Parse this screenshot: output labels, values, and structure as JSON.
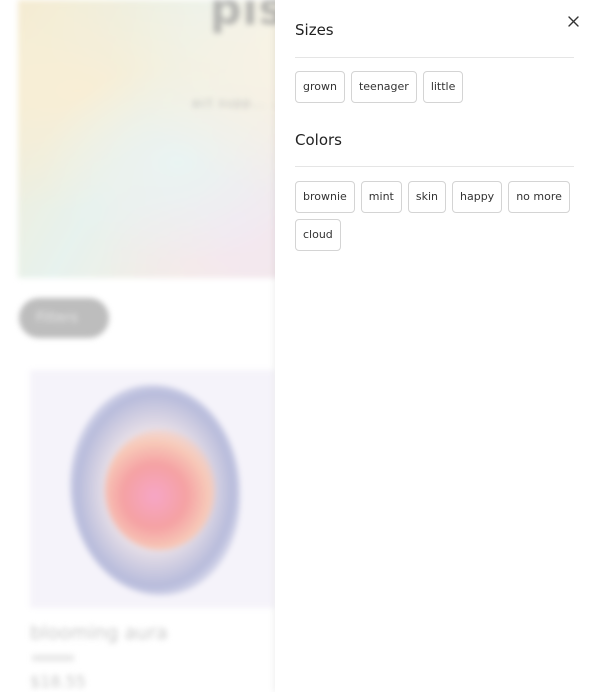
{
  "background": {
    "hero_title": "pisc",
    "hero_subtitle": "act supp... ... fro ...",
    "filter_button_label": "Filters",
    "product": {
      "name": "blooming aura",
      "price": "$18.55"
    }
  },
  "drawer": {
    "close_icon": "close-icon",
    "sizes": {
      "title": "Sizes",
      "options": [
        "grown",
        "teenager",
        "little"
      ]
    },
    "colors": {
      "title": "Colors",
      "options": [
        "brownie",
        "mint",
        "skin",
        "happy",
        "no more",
        "cloud"
      ]
    }
  }
}
